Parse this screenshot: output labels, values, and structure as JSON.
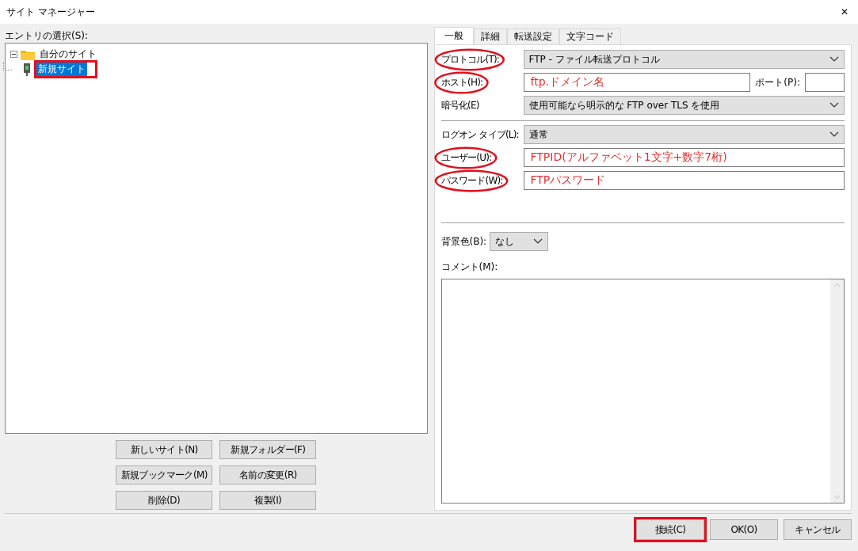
{
  "window": {
    "title": "サイト マネージャー",
    "close": "✕"
  },
  "entry_label": "エントリの選択(S):",
  "tree": [
    {
      "label": "自分のサイト",
      "kind": "folder",
      "expanded": true,
      "selected": false,
      "annotated": false,
      "children": [
        {
          "label": "新規サイト",
          "kind": "site",
          "selected": true,
          "annotated": true
        }
      ]
    }
  ],
  "tree_buttons": [
    "新しいサイト(N)",
    "新規フォルダー(F)",
    "新規ブックマーク(M)",
    "名前の変更(R)",
    "削除(D)",
    "複製(I)"
  ],
  "tabs": [
    {
      "label": "一般",
      "selected": true
    },
    {
      "label": "詳細",
      "selected": false
    },
    {
      "label": "転送設定",
      "selected": false
    },
    {
      "label": "文字コード",
      "selected": false
    }
  ],
  "form": [
    {
      "kind": "select",
      "label": "プロトコル(T):",
      "value": "FTP - ファイル転送プロトコル",
      "circled": true
    },
    {
      "kind": "text",
      "label": "ホスト(H):",
      "value": "ftp.ドメイン名",
      "circled": true,
      "port_label": "ポート(P):"
    },
    {
      "kind": "select",
      "label": "暗号化(E)",
      "value": "使用可能なら明示的な FTP over TLS を使用",
      "circled": false
    },
    {
      "kind": "separator"
    },
    {
      "kind": "select",
      "label": "ログオン タイプ(L):",
      "value": "通常",
      "circled": false
    },
    {
      "kind": "text",
      "label": "ユーザー(U):",
      "value": "FTPID(アルファベット1文字+数字7桁)",
      "circled": true
    },
    {
      "kind": "text",
      "label": "パスワード(W):",
      "value": "FTPパスワード",
      "circled": true
    }
  ],
  "background_color": {
    "label": "背景色(B):",
    "value": "なし"
  },
  "comment": {
    "label": "コメント(M):"
  },
  "footer_buttons": [
    {
      "label": "接続(C)",
      "annotated": true
    },
    {
      "label": "OK(O)",
      "annotated": false
    },
    {
      "label": "キャンセル",
      "annotated": false
    }
  ]
}
